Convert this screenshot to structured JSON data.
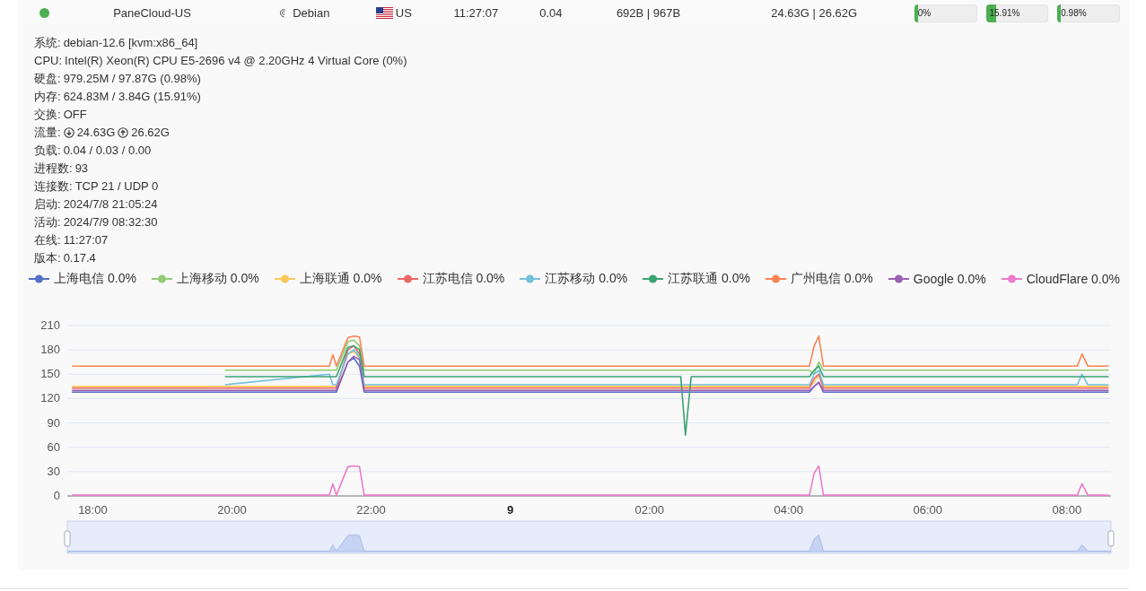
{
  "server": {
    "online": true,
    "name": "PaneCloud-US",
    "os": "Debian",
    "region": "US",
    "uptime": "11:27:07",
    "load": "0.04",
    "net_speed": "692B | 967B",
    "traffic": "24.63G | 26.62G",
    "meters": [
      {
        "label": "0%",
        "level": 0
      },
      {
        "label": "15.91%",
        "level": 0.1591
      },
      {
        "label": "0.98%",
        "level": 0.0098
      }
    ]
  },
  "details": [
    {
      "kind": "text",
      "label": "系统:",
      "value": "debian-12.6 [kvm:x86_64]"
    },
    {
      "kind": "text",
      "label": "CPU:",
      "value": "Intel(R) Xeon(R) CPU E5-2696 v4 @ 2.20GHz 4 Virtual Core (0%)"
    },
    {
      "kind": "text",
      "label": "硬盘:",
      "value": "979.25M / 97.87G (0.98%)"
    },
    {
      "kind": "text",
      "label": "内存:",
      "value": "624.83M / 3.84G (15.91%)"
    },
    {
      "kind": "text",
      "label": "交换:",
      "value": "OFF"
    },
    {
      "kind": "traffic",
      "label": "流量:",
      "download": "24.63G",
      "upload": "26.62G"
    },
    {
      "kind": "text",
      "label": "负载:",
      "value": "0.04 / 0.03 / 0.00"
    },
    {
      "kind": "text",
      "label": "进程数:",
      "value": "93"
    },
    {
      "kind": "text",
      "label": "连接数:",
      "value": "TCP 21 / UDP 0"
    },
    {
      "kind": "text",
      "label": "启动:",
      "value": "2024/7/8 21:05:24"
    },
    {
      "kind": "text",
      "label": "活动:",
      "value": "2024/7/9 08:32:30"
    },
    {
      "kind": "text",
      "label": "在线:",
      "value": "11:27:07"
    },
    {
      "kind": "text",
      "label": "版本:",
      "value": "0.17.4"
    }
  ],
  "legend": [
    "0.0%",
    "0.0%",
    "0.0%",
    "0.0%",
    "0.0%",
    "0.0%",
    "0.0%",
    "0.0%",
    "0.0%"
  ],
  "chart_data": {
    "type": "line",
    "grid": true,
    "x": [
      "2024-07-08 17:42",
      "2024-07-08 19:48",
      "2024-07-08 19:54",
      "2024-07-08 21:24",
      "2024-07-08 21:27",
      "2024-07-08 21:30",
      "2024-07-08 21:40",
      "2024-07-08 21:45",
      "2024-07-08 21:50",
      "2024-07-08 21:54",
      "2024-07-08 23:00",
      "2024-07-09 00:00",
      "2024-07-09 01:00",
      "2024-07-09 02:00",
      "2024-07-09 02:27",
      "2024-07-09 02:31",
      "2024-07-09 02:36",
      "2024-07-09 03:00",
      "2024-07-09 04:00",
      "2024-07-09 04:18",
      "2024-07-09 04:22",
      "2024-07-09 04:26",
      "2024-07-09 04:30",
      "2024-07-09 05:00",
      "2024-07-09 06:00",
      "2024-07-09 07:00",
      "2024-07-09 08:09",
      "2024-07-09 08:13",
      "2024-07-09 08:18",
      "2024-07-09 08:36"
    ],
    "xlim": [
      "2024-07-08 17:38",
      "2024-07-09 08:38"
    ],
    "ylim": [
      0,
      210
    ],
    "xticks": [
      {
        "value": "2024-07-08 18:00",
        "label": "18:00"
      },
      {
        "value": "2024-07-08 20:00",
        "label": "20:00"
      },
      {
        "value": "2024-07-08 22:00",
        "label": "22:00"
      },
      {
        "value": "2024-07-09 00:00",
        "label": "9"
      },
      {
        "value": "2024-07-09 02:00",
        "label": "02:00"
      },
      {
        "value": "2024-07-09 04:00",
        "label": "04:00"
      },
      {
        "value": "2024-07-09 06:00",
        "label": "06:00"
      },
      {
        "value": "2024-07-09 08:00",
        "label": "08:00"
      }
    ],
    "yticks": [
      0,
      30,
      60,
      90,
      120,
      150,
      180,
      210
    ],
    "series": [
      {
        "name": "上海电信",
        "color": "#5470c6",
        "values": [
          128,
          128,
          128,
          128,
          128,
          128,
          165,
          170,
          160,
          128,
          128,
          128,
          128,
          128,
          128,
          128,
          128,
          128,
          128,
          128,
          135,
          140,
          128,
          128,
          128,
          128,
          128,
          128,
          128,
          128
        ]
      },
      {
        "name": "上海移动",
        "color": "#91cc75",
        "values": [
          null,
          null,
          155,
          155,
          155,
          155,
          190,
          192,
          185,
          155,
          155,
          155,
          155,
          155,
          155,
          155,
          155,
          155,
          155,
          155,
          150,
          165,
          155,
          155,
          155,
          155,
          155,
          155,
          155,
          155
        ]
      },
      {
        "name": "上海联通",
        "color": "#fac858",
        "values": [
          135,
          135,
          135,
          135,
          135,
          135,
          175,
          178,
          170,
          135,
          135,
          135,
          135,
          135,
          135,
          135,
          135,
          135,
          135,
          135,
          140,
          150,
          135,
          135,
          135,
          135,
          135,
          135,
          135,
          135
        ]
      },
      {
        "name": "江苏电信",
        "color": "#ee6666",
        "values": [
          133,
          133,
          133,
          133,
          133,
          133,
          180,
          185,
          175,
          133,
          133,
          133,
          133,
          133,
          133,
          133,
          133,
          133,
          133,
          133,
          145,
          150,
          133,
          133,
          133,
          133,
          133,
          133,
          133,
          133
        ]
      },
      {
        "name": "江苏移动",
        "color": "#73c0de",
        "values": [
          null,
          null,
          137,
          150,
          137,
          137,
          175,
          180,
          172,
          137,
          137,
          137,
          137,
          137,
          137,
          137,
          137,
          137,
          137,
          137,
          150,
          155,
          137,
          137,
          137,
          137,
          137,
          150,
          137,
          137
        ]
      },
      {
        "name": "江苏联通",
        "color": "#3ba272",
        "values": [
          null,
          null,
          147,
          147,
          147,
          147,
          183,
          185,
          180,
          147,
          147,
          147,
          147,
          147,
          147,
          75,
          147,
          147,
          147,
          147,
          155,
          160,
          147,
          147,
          147,
          147,
          147,
          147,
          147,
          147
        ]
      },
      {
        "name": "广州电信",
        "color": "#fc8452",
        "values": [
          160,
          160,
          160,
          160,
          174,
          160,
          195,
          197,
          196,
          160,
          160,
          160,
          160,
          160,
          160,
          160,
          160,
          160,
          160,
          160,
          185,
          197,
          160,
          160,
          160,
          160,
          160,
          175,
          160,
          160
        ]
      },
      {
        "name": "Google",
        "color": "#9a60b4",
        "values": [
          130,
          130,
          130,
          130,
          130,
          130,
          165,
          172,
          168,
          130,
          130,
          130,
          130,
          130,
          130,
          130,
          130,
          130,
          130,
          130,
          135,
          140,
          130,
          130,
          130,
          130,
          130,
          130,
          130,
          130
        ]
      },
      {
        "name": "CloudFlare",
        "color": "#ea7ccc",
        "values": [
          1,
          1,
          1,
          1,
          15,
          1,
          36,
          37,
          36,
          1,
          1,
          1,
          1,
          1,
          1,
          1,
          1,
          1,
          1,
          1,
          28,
          37,
          1,
          1,
          1,
          1,
          1,
          15,
          1,
          1
        ]
      }
    ]
  }
}
